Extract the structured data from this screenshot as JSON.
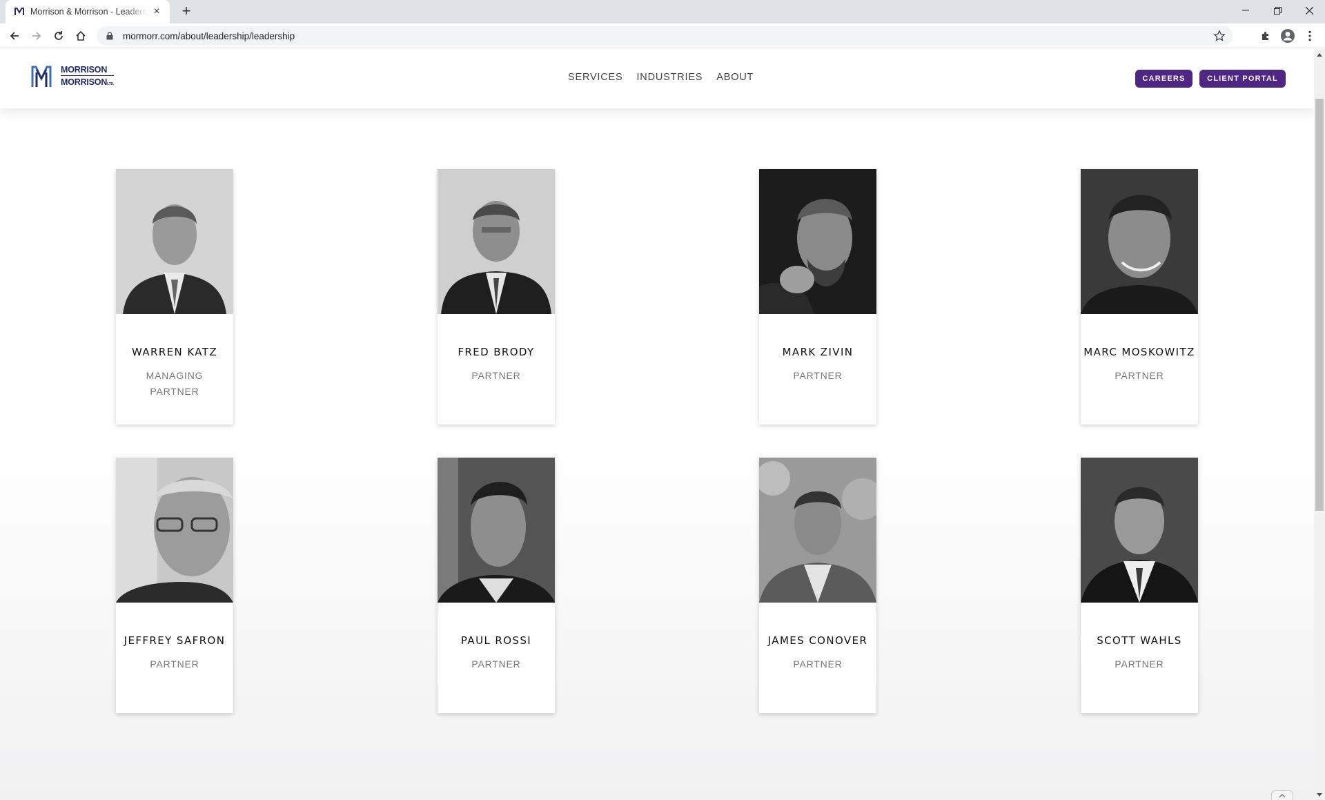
{
  "browser": {
    "tab_title": "Morrison & Morrison - Leadership",
    "url": "mormorr.com/about/leadership/leadership",
    "new_tab_label": "+",
    "close_tab_label": "×"
  },
  "site": {
    "logo_line1": "MORRISON",
    "logo_line2": "MORRISON",
    "logo_suffix": "LTD.",
    "nav": [
      "SERVICES",
      "INDUSTRIES",
      "ABOUT"
    ],
    "careers_label": "CAREERS",
    "portal_label": "CLIENT PORTAL",
    "accent_color": "#4f2683",
    "logo_color": "#222a6b"
  },
  "leaders": [
    {
      "name": "WARREN KATZ",
      "title": "MANAGING PARTNER"
    },
    {
      "name": "FRED BRODY",
      "title": "PARTNER"
    },
    {
      "name": "MARK ZIVIN",
      "title": "PARTNER"
    },
    {
      "name": "MARC MOSKOWITZ",
      "title": "PARTNER"
    },
    {
      "name": "JEFFREY SAFRON",
      "title": "PARTNER"
    },
    {
      "name": "PAUL ROSSI",
      "title": "PARTNER"
    },
    {
      "name": "JAMES CONOVER",
      "title": "PARTNER"
    },
    {
      "name": "SCOTT WAHLS",
      "title": "PARTNER"
    }
  ]
}
